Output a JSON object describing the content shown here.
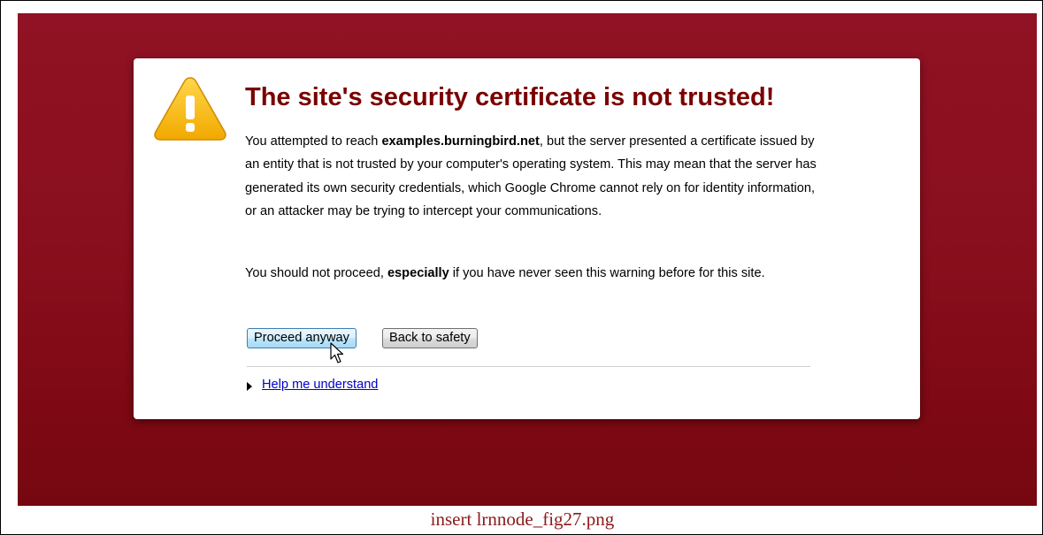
{
  "dialog": {
    "title": "The site's security certificate is not trusted!",
    "paragraph1": {
      "part1": "You attempted to reach ",
      "host": "examples.burningbird.net",
      "part2": ", but the server presented a certificate issued by an entity that is not trusted by your computer's operating system. This may mean that the server has generated its own security credentials, which Google Chrome cannot rely on for identity information, or an attacker may be trying to intercept your communications."
    },
    "paragraph2": {
      "part1": "You should not proceed, ",
      "emphasis": "especially",
      "part2": " if you have never seen this warning before for this site."
    },
    "buttons": {
      "proceed": "Proceed anyway",
      "back": "Back to safety"
    },
    "help_link": "Help me understand",
    "icon": "warning-icon"
  },
  "caption": "insert lrnnode_fig27.png",
  "colors": {
    "background_top": "#901224",
    "background_bottom": "#760710",
    "title": "#7a0000",
    "link": "#0000cc",
    "caption": "#8b1a1a"
  }
}
